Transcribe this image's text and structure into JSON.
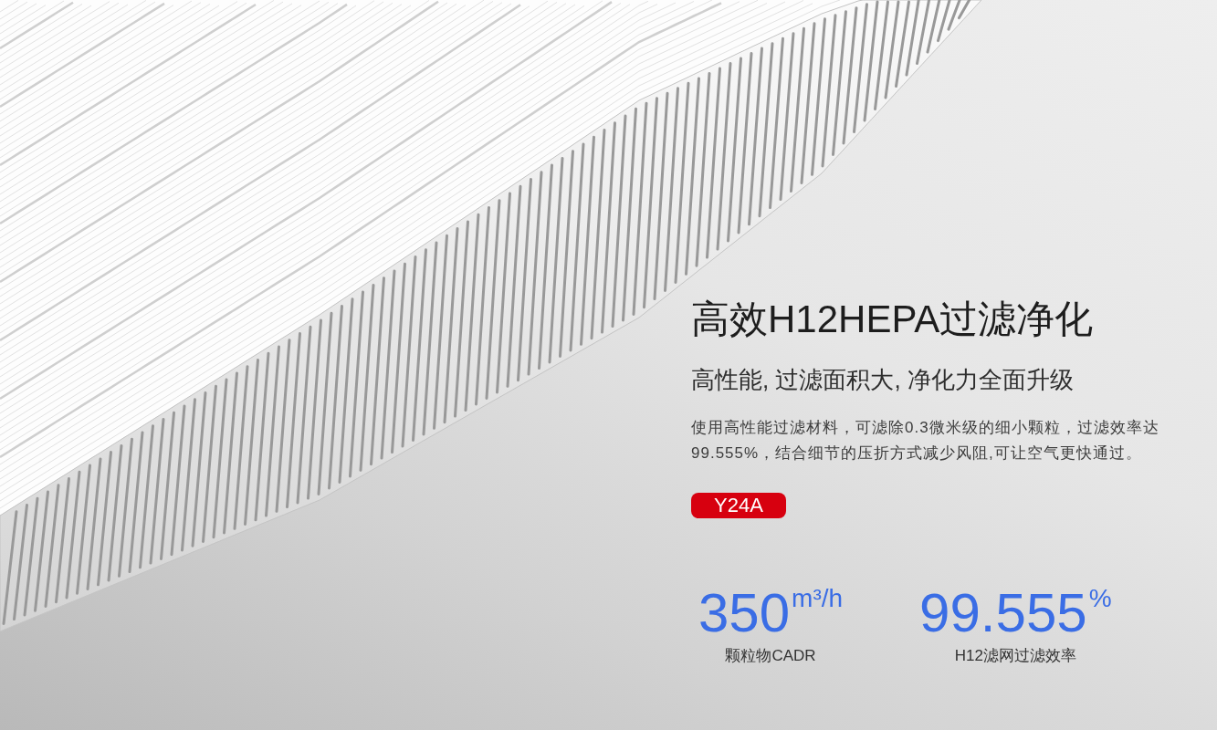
{
  "heading": "高效H12HEPA过滤净化",
  "subheading": "高性能, 过滤面积大, 净化力全面升级",
  "description": "使用高性能过滤材料，可滤除0.3微米级的细小颗粒，过滤效率达99.555%，结合细节的压折方式减少风阻,可让空气更快通过。",
  "model_tag": "Y24A",
  "stats": [
    {
      "value": "350",
      "unit": "m³/h",
      "label": "颗粒物CADR"
    },
    {
      "value": "99.555",
      "unit": "%",
      "label": "H12滤网过滤效率"
    }
  ]
}
